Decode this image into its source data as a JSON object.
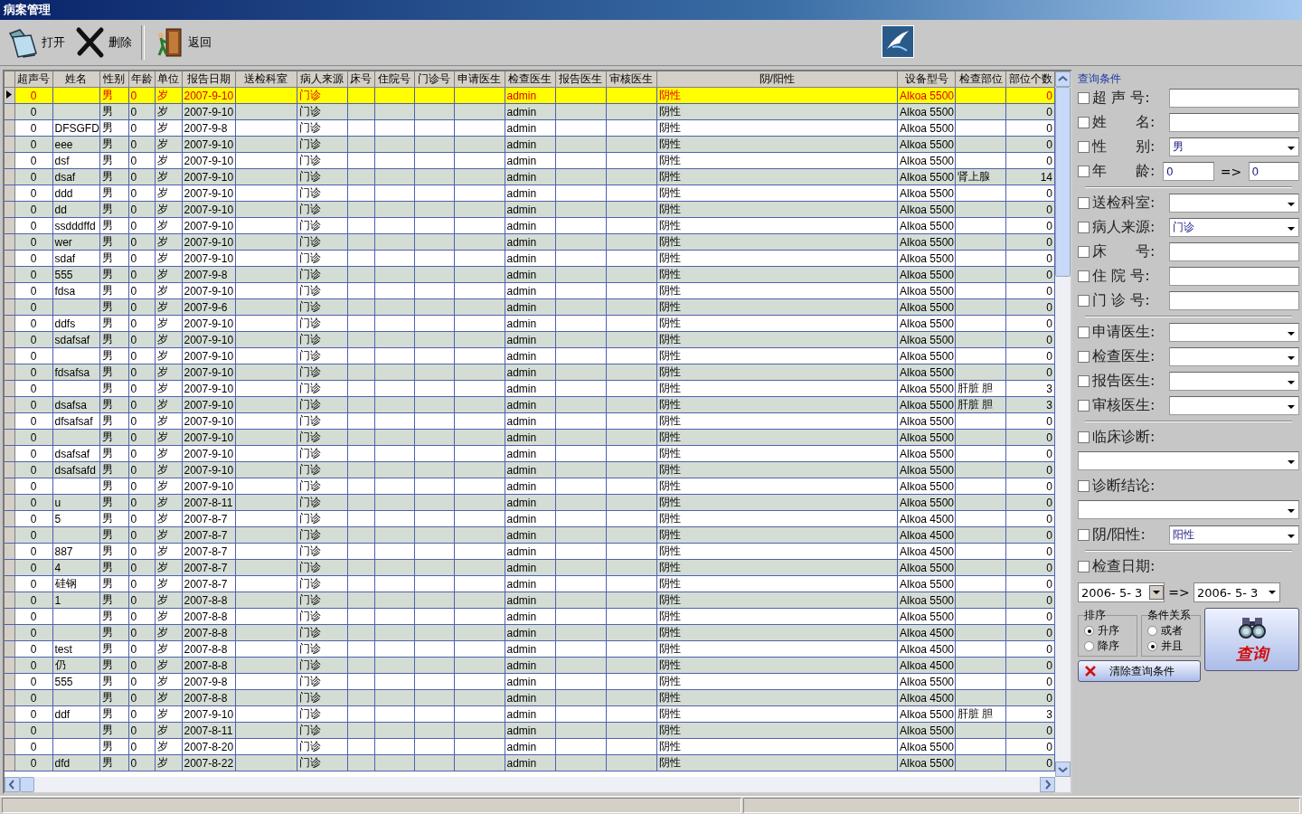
{
  "window": {
    "title": "病案管理"
  },
  "toolbar": [
    "打开",
    "删除",
    "返回"
  ],
  "table": {
    "columns": [
      "超声号",
      "姓名",
      "性别",
      "年龄",
      "单位",
      "报告日期",
      "送检科室",
      "病人来源",
      "床号",
      "住院号",
      "门诊号",
      "申请医生",
      "检查医生",
      "报告医生",
      "审核医生",
      "阴/阳性",
      "设备型号",
      "检查部位",
      "部位个数"
    ],
    "rows": [
      {
        "selected": true,
        "no": "0",
        "sex": "男",
        "age": "0",
        "unit": "岁",
        "date": "2007-9-10",
        "source": "门诊",
        "doctor": "admin",
        "result": "阴性",
        "device": "Alkoa 5500",
        "count": "0"
      },
      {
        "selected": false,
        "no": "0",
        "sex": "男",
        "age": "0",
        "unit": "岁",
        "date": "2007-9-10",
        "source": "门诊",
        "doctor": "admin",
        "result": "阴性",
        "device": "Alkoa 5500",
        "count": "0"
      },
      {
        "selected": false,
        "no": "0",
        "name": "DFSGFD",
        "sex": "男",
        "age": "0",
        "unit": "岁",
        "date": "2007-9-8",
        "source": "门诊",
        "doctor": "admin",
        "result": "阴性",
        "device": "Alkoa 5500",
        "count": "0"
      },
      {
        "selected": false,
        "no": "0",
        "name": "eee",
        "sex": "男",
        "age": "0",
        "unit": "岁",
        "date": "2007-9-10",
        "source": "门诊",
        "doctor": "admin",
        "result": "阴性",
        "device": "Alkoa 5500",
        "count": "0"
      },
      {
        "selected": false,
        "no": "0",
        "name": "dsf",
        "sex": "男",
        "age": "0",
        "unit": "岁",
        "date": "2007-9-10",
        "source": "门诊",
        "doctor": "admin",
        "result": "阴性",
        "device": "Alkoa 5500",
        "count": "0"
      },
      {
        "selected": false,
        "no": "0",
        "name": "dsaf",
        "sex": "男",
        "age": "0",
        "unit": "岁",
        "date": "2007-9-10",
        "source": "门诊",
        "doctor": "admin",
        "result": "阴性",
        "device": "Alkoa 5500",
        "site": "肾上腺",
        "count": "14"
      },
      {
        "selected": false,
        "no": "0",
        "name": "ddd",
        "sex": "男",
        "age": "0",
        "unit": "岁",
        "date": "2007-9-10",
        "source": "门诊",
        "doctor": "admin",
        "result": "阴性",
        "device": "Alkoa 5500",
        "count": "0"
      },
      {
        "selected": false,
        "no": "0",
        "name": "dd",
        "sex": "男",
        "age": "0",
        "unit": "岁",
        "date": "2007-9-10",
        "source": "门诊",
        "doctor": "admin",
        "result": "阴性",
        "device": "Alkoa 5500",
        "count": "0"
      },
      {
        "selected": false,
        "no": "0",
        "name": "ssdddffd",
        "sex": "男",
        "age": "0",
        "unit": "岁",
        "date": "2007-9-10",
        "source": "门诊",
        "doctor": "admin",
        "result": "阴性",
        "device": "Alkoa 5500",
        "count": "0"
      },
      {
        "selected": false,
        "no": "0",
        "name": "wer",
        "sex": "男",
        "age": "0",
        "unit": "岁",
        "date": "2007-9-10",
        "source": "门诊",
        "doctor": "admin",
        "result": "阴性",
        "device": "Alkoa 5500",
        "count": "0"
      },
      {
        "selected": false,
        "no": "0",
        "name": "sdaf",
        "sex": "男",
        "age": "0",
        "unit": "岁",
        "date": "2007-9-10",
        "source": "门诊",
        "doctor": "admin",
        "result": "阴性",
        "device": "Alkoa 5500",
        "count": "0"
      },
      {
        "selected": false,
        "no": "0",
        "name": "555",
        "sex": "男",
        "age": "0",
        "unit": "岁",
        "date": "2007-9-8",
        "source": "门诊",
        "doctor": "admin",
        "result": "阴性",
        "device": "Alkoa 5500",
        "count": "0"
      },
      {
        "selected": false,
        "no": "0",
        "name": "fdsa",
        "sex": "男",
        "age": "0",
        "unit": "岁",
        "date": "2007-9-10",
        "source": "门诊",
        "doctor": "admin",
        "result": "阴性",
        "device": "Alkoa 5500",
        "count": "0"
      },
      {
        "selected": false,
        "no": "0",
        "sex": "男",
        "age": "0",
        "unit": "岁",
        "date": "2007-9-6",
        "source": "门诊",
        "doctor": "admin",
        "result": "阴性",
        "device": "Alkoa 5500",
        "count": "0"
      },
      {
        "selected": false,
        "no": "0",
        "name": "ddfs",
        "sex": "男",
        "age": "0",
        "unit": "岁",
        "date": "2007-9-10",
        "source": "门诊",
        "doctor": "admin",
        "result": "阴性",
        "device": "Alkoa 5500",
        "count": "0"
      },
      {
        "selected": false,
        "no": "0",
        "name": "sdafsaf",
        "sex": "男",
        "age": "0",
        "unit": "岁",
        "date": "2007-9-10",
        "source": "门诊",
        "doctor": "admin",
        "result": "阴性",
        "device": "Alkoa 5500",
        "count": "0"
      },
      {
        "selected": false,
        "no": "0",
        "sex": "男",
        "age": "0",
        "unit": "岁",
        "date": "2007-9-10",
        "source": "门诊",
        "doctor": "admin",
        "result": "阴性",
        "device": "Alkoa 5500",
        "count": "0"
      },
      {
        "selected": false,
        "no": "0",
        "name": "fdsafsa",
        "sex": "男",
        "age": "0",
        "unit": "岁",
        "date": "2007-9-10",
        "source": "门诊",
        "doctor": "admin",
        "result": "阴性",
        "device": "Alkoa 5500",
        "count": "0"
      },
      {
        "selected": false,
        "no": "0",
        "sex": "男",
        "age": "0",
        "unit": "岁",
        "date": "2007-9-10",
        "source": "门诊",
        "doctor": "admin",
        "result": "阴性",
        "device": "Alkoa 5500",
        "site": "肝脏 胆",
        "count": "3"
      },
      {
        "selected": false,
        "no": "0",
        "name": "dsafsa",
        "sex": "男",
        "age": "0",
        "unit": "岁",
        "date": "2007-9-10",
        "source": "门诊",
        "doctor": "admin",
        "result": "阴性",
        "device": "Alkoa 5500",
        "site": "肝脏 胆",
        "count": "3"
      },
      {
        "selected": false,
        "no": "0",
        "name": "dfsafsaf",
        "sex": "男",
        "age": "0",
        "unit": "岁",
        "date": "2007-9-10",
        "source": "门诊",
        "doctor": "admin",
        "result": "阴性",
        "device": "Alkoa 5500",
        "count": "0"
      },
      {
        "selected": false,
        "no": "0",
        "sex": "男",
        "age": "0",
        "unit": "岁",
        "date": "2007-9-10",
        "source": "门诊",
        "doctor": "admin",
        "result": "阴性",
        "device": "Alkoa 5500",
        "count": "0"
      },
      {
        "selected": false,
        "no": "0",
        "name": "dsafsaf",
        "sex": "男",
        "age": "0",
        "unit": "岁",
        "date": "2007-9-10",
        "source": "门诊",
        "doctor": "admin",
        "result": "阴性",
        "device": "Alkoa 5500",
        "count": "0"
      },
      {
        "selected": false,
        "no": "0",
        "name": "dsafsafd",
        "sex": "男",
        "age": "0",
        "unit": "岁",
        "date": "2007-9-10",
        "source": "门诊",
        "doctor": "admin",
        "result": "阴性",
        "device": "Alkoa 5500",
        "count": "0"
      },
      {
        "selected": false,
        "no": "0",
        "sex": "男",
        "age": "0",
        "unit": "岁",
        "date": "2007-9-10",
        "source": "门诊",
        "doctor": "admin",
        "result": "阴性",
        "device": "Alkoa 5500",
        "count": "0"
      },
      {
        "selected": false,
        "no": "0",
        "name": "u",
        "sex": "男",
        "age": "0",
        "unit": "岁",
        "date": "2007-8-11",
        "source": "门诊",
        "doctor": "admin",
        "result": "阴性",
        "device": "Alkoa 5500",
        "count": "0"
      },
      {
        "selected": false,
        "no": "0",
        "name": "5",
        "sex": "男",
        "age": "0",
        "unit": "岁",
        "date": "2007-8-7",
        "source": "门诊",
        "doctor": "admin",
        "result": "阴性",
        "device": "Alkoa 4500",
        "count": "0"
      },
      {
        "selected": false,
        "no": "0",
        "sex": "男",
        "age": "0",
        "unit": "岁",
        "date": "2007-8-7",
        "source": "门诊",
        "doctor": "admin",
        "result": "阴性",
        "device": "Alkoa 4500",
        "count": "0"
      },
      {
        "selected": false,
        "no": "0",
        "name": "887",
        "sex": "男",
        "age": "0",
        "unit": "岁",
        "date": "2007-8-7",
        "source": "门诊",
        "doctor": "admin",
        "result": "阴性",
        "device": "Alkoa 4500",
        "count": "0"
      },
      {
        "selected": false,
        "no": "0",
        "name": "4",
        "sex": "男",
        "age": "0",
        "unit": "岁",
        "date": "2007-8-7",
        "source": "门诊",
        "doctor": "admin",
        "result": "阴性",
        "device": "Alkoa 5500",
        "count": "0"
      },
      {
        "selected": false,
        "no": "0",
        "name": "硅钢",
        "sex": "男",
        "age": "0",
        "unit": "岁",
        "date": "2007-8-7",
        "source": "门诊",
        "doctor": "admin",
        "result": "阴性",
        "device": "Alkoa 5500",
        "count": "0"
      },
      {
        "selected": false,
        "no": "0",
        "name": "1",
        "sex": "男",
        "age": "0",
        "unit": "岁",
        "date": "2007-8-8",
        "source": "门诊",
        "doctor": "admin",
        "result": "阴性",
        "device": "Alkoa 5500",
        "count": "0"
      },
      {
        "selected": false,
        "no": "0",
        "sex": "男",
        "age": "0",
        "unit": "岁",
        "date": "2007-8-8",
        "source": "门诊",
        "doctor": "admin",
        "result": "阴性",
        "device": "Alkoa 5500",
        "count": "0"
      },
      {
        "selected": false,
        "no": "0",
        "sex": "男",
        "age": "0",
        "unit": "岁",
        "date": "2007-8-8",
        "source": "门诊",
        "doctor": "admin",
        "result": "阴性",
        "device": "Alkoa 4500",
        "count": "0"
      },
      {
        "selected": false,
        "no": "0",
        "name": "test",
        "sex": "男",
        "age": "0",
        "unit": "岁",
        "date": "2007-8-8",
        "source": "门诊",
        "doctor": "admin",
        "result": "阴性",
        "device": "Alkoa 4500",
        "count": "0"
      },
      {
        "selected": false,
        "no": "0",
        "name": "仍",
        "sex": "男",
        "age": "0",
        "unit": "岁",
        "date": "2007-8-8",
        "source": "门诊",
        "doctor": "admin",
        "result": "阴性",
        "device": "Alkoa 4500",
        "count": "0"
      },
      {
        "selected": false,
        "no": "0",
        "name": "555",
        "sex": "男",
        "age": "0",
        "unit": "岁",
        "date": "2007-9-8",
        "source": "门诊",
        "doctor": "admin",
        "result": "阴性",
        "device": "Alkoa 5500",
        "count": "0"
      },
      {
        "selected": false,
        "no": "0",
        "sex": "男",
        "age": "0",
        "unit": "岁",
        "date": "2007-8-8",
        "source": "门诊",
        "doctor": "admin",
        "result": "阴性",
        "device": "Alkoa 4500",
        "count": "0"
      },
      {
        "selected": false,
        "no": "0",
        "name": "ddf",
        "sex": "男",
        "age": "0",
        "unit": "岁",
        "date": "2007-9-10",
        "source": "门诊",
        "doctor": "admin",
        "result": "阴性",
        "device": "Alkoa 5500",
        "site": "肝脏 胆",
        "count": "3"
      },
      {
        "selected": false,
        "no": "0",
        "sex": "男",
        "age": "0",
        "unit": "岁",
        "date": "2007-8-11",
        "source": "门诊",
        "doctor": "admin",
        "result": "阴性",
        "device": "Alkoa 5500",
        "count": "0"
      },
      {
        "selected": false,
        "no": "0",
        "sex": "男",
        "age": "0",
        "unit": "岁",
        "date": "2007-8-20",
        "source": "门诊",
        "doctor": "admin",
        "result": "阴性",
        "device": "Alkoa 5500",
        "count": "0"
      },
      {
        "selected": false,
        "no": "0",
        "name": "dfd",
        "sex": "男",
        "age": "0",
        "unit": "岁",
        "date": "2007-8-22",
        "source": "门诊",
        "doctor": "admin",
        "result": "阴性",
        "device": "Alkoa 5500",
        "count": "0"
      }
    ]
  },
  "query_panel": {
    "title": "查询条件",
    "groups": [
      [
        {
          "label": "超 声 号:",
          "kind": "text",
          "checked": false
        },
        {
          "label": "姓　　名:",
          "kind": "text",
          "checked": false
        },
        {
          "label": "性　　别:",
          "kind": "combo",
          "checked": false,
          "value": "男"
        },
        {
          "label": "年　　龄:",
          "kind": "range",
          "checked": false,
          "from": "0",
          "separator": "=>",
          "to": "0"
        }
      ],
      [
        {
          "label": "送检科室:",
          "kind": "combo",
          "checked": false
        },
        {
          "label": "病人来源:",
          "kind": "combo",
          "checked": false,
          "value": "门诊"
        },
        {
          "label": "床　　号:",
          "kind": "text",
          "checked": false
        },
        {
          "label": "住 院 号:",
          "kind": "text",
          "checked": false
        },
        {
          "label": "门 诊 号:",
          "kind": "text",
          "checked": false
        }
      ],
      [
        {
          "label": "申请医生:",
          "kind": "combo",
          "checked": false
        },
        {
          "label": "检查医生:",
          "kind": "combo",
          "checked": false
        },
        {
          "label": "报告医生:",
          "kind": "combo",
          "checked": false
        },
        {
          "label": "审核医生:",
          "kind": "combo",
          "checked": false
        }
      ],
      [
        {
          "label": "临床诊断:",
          "kind": "combo_below",
          "checked": false
        },
        {
          "label": "诊断结论:",
          "kind": "combo_below",
          "checked": false
        },
        {
          "label": "阴/阳性:",
          "kind": "combo",
          "checked": false,
          "value": "阳性"
        }
      ],
      [
        {
          "label": "检查日期:",
          "kind": "date_range",
          "checked": false,
          "from": "2006- 5- 3",
          "separator": "=>",
          "to": "2006- 5- 3"
        }
      ]
    ],
    "sort": {
      "title": "排序",
      "options": [
        {
          "label": "升序",
          "selected": true
        },
        {
          "label": "降序",
          "selected": false
        }
      ]
    },
    "relation": {
      "title": "条件关系",
      "options": [
        {
          "label": "或者",
          "selected": false
        },
        {
          "label": "并且",
          "selected": true
        }
      ]
    },
    "clear_button": "清除查询条件",
    "query_button": "查询"
  }
}
